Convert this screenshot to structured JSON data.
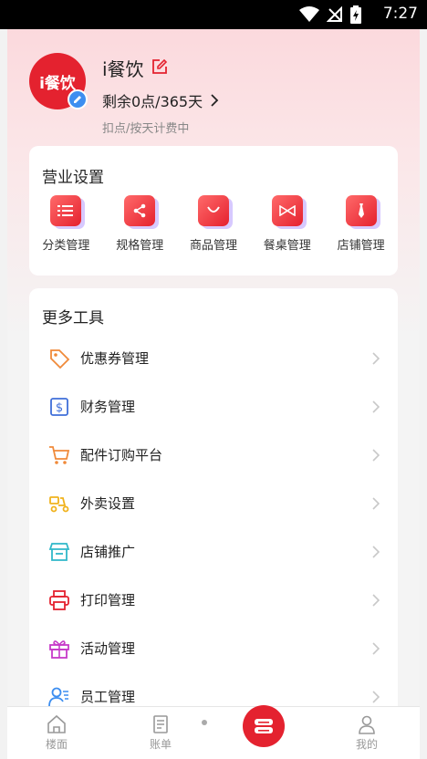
{
  "status_bar": {
    "time": "7:27",
    "icons": [
      "wifi-icon",
      "no-signal-icon",
      "battery-charging-icon"
    ]
  },
  "profile": {
    "avatar_text": "i餐饮",
    "shop_name": "i餐饮",
    "remaining": "剩余0点/365天",
    "billing": "扣点/按天计费中"
  },
  "business": {
    "title": "营业设置",
    "items": [
      {
        "label": "分类管理",
        "icon": "list-icon"
      },
      {
        "label": "规格管理",
        "icon": "share-icon"
      },
      {
        "label": "商品管理",
        "icon": "bag-icon"
      },
      {
        "label": "餐桌管理",
        "icon": "bowtie-icon"
      },
      {
        "label": "店铺管理",
        "icon": "tie-icon"
      }
    ]
  },
  "tools": {
    "title": "更多工具",
    "items": [
      {
        "label": "优惠券管理",
        "icon": "coupon-icon",
        "color": "#f08a3a"
      },
      {
        "label": "财务管理",
        "icon": "dollar-icon",
        "color": "#3f6fd9"
      },
      {
        "label": "配件订购平台",
        "icon": "cart-icon",
        "color": "#f08a3a"
      },
      {
        "label": "外卖设置",
        "icon": "scooter-icon",
        "color": "#f0b21c"
      },
      {
        "label": "店铺推广",
        "icon": "store-icon",
        "color": "#2fb8c9"
      },
      {
        "label": "打印管理",
        "icon": "printer-icon",
        "color": "#e4222f"
      },
      {
        "label": "活动管理",
        "icon": "gift-icon",
        "color": "#c63ac9"
      },
      {
        "label": "员工管理",
        "icon": "staff-icon",
        "color": "#3d8ef0"
      }
    ]
  },
  "tabbar": {
    "items": [
      {
        "label": "楼面",
        "icon": "home-icon"
      },
      {
        "label": "账单",
        "icon": "bill-icon"
      },
      {
        "label": "",
        "icon": "cashier-icon"
      },
      {
        "label": "我的",
        "icon": "user-icon"
      }
    ]
  },
  "colors": {
    "accent": "#e4222f"
  }
}
